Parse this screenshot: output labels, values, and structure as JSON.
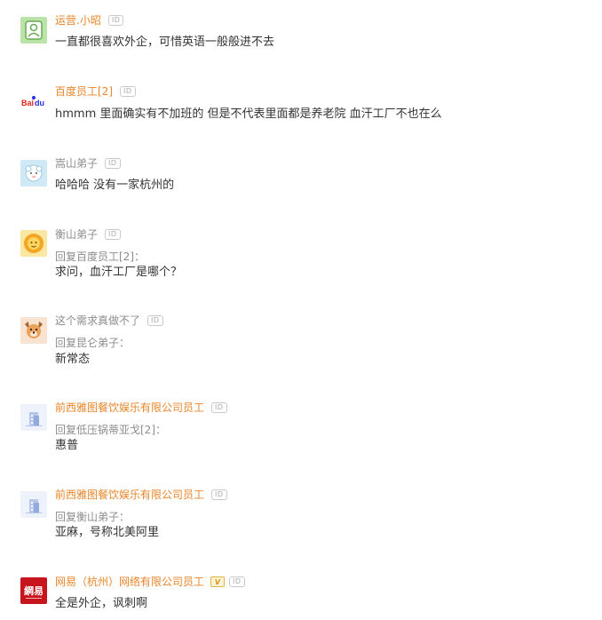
{
  "comments": [
    {
      "username": "运营.小昭",
      "name_style": "org",
      "id_badge": "ID",
      "avatar_icon": "green-person-avatar-icon",
      "text": "一直都很喜欢外企，可惜英语一般般进不去"
    },
    {
      "username": "百度员工[2]",
      "name_style": "org",
      "id_badge": "ID",
      "avatar_icon": "baidu-logo-icon",
      "text": "hmmm 里面确实有不加班的 但是不代表里面都是养老院 血汗工厂不也在么"
    },
    {
      "username": "嵩山弟子",
      "name_style": "anon",
      "id_badge": "ID",
      "avatar_icon": "sheep-avatar-icon",
      "text": "哈哈哈 没有一家杭州的"
    },
    {
      "username": "衡山弟子",
      "name_style": "anon",
      "id_badge": "ID",
      "avatar_icon": "lion-avatar-icon",
      "reply_to": "回复百度员工[2]：",
      "text": "求问，血汗工厂是哪个？"
    },
    {
      "username": "这个需求真做不了",
      "name_style": "anon",
      "id_badge": "ID",
      "avatar_icon": "dog-avatar-icon",
      "reply_to": "回复昆仑弟子：",
      "text": "新常态"
    },
    {
      "username": "前西雅图餐饮娱乐有限公司员工",
      "name_style": "org",
      "id_badge": "ID",
      "avatar_icon": "building-icon",
      "reply_to": "回复低压锅蒂亚戈[2]：",
      "text": "惠普"
    },
    {
      "username": "前西雅图餐饮娱乐有限公司员工",
      "name_style": "org",
      "id_badge": "ID",
      "avatar_icon": "building-icon",
      "reply_to": "回复衡山弟子：",
      "text": "亚麻，号称北美阿里"
    },
    {
      "username": "网易（杭州）网络有限公司员工",
      "name_style": "org",
      "verified_badge": "V",
      "id_badge": "ID",
      "avatar_icon": "netease-logo-icon",
      "avatar_text": "網易",
      "text": "全是外企，讽刺啊"
    }
  ],
  "colors": {
    "org_name": "#e8862a",
    "anon_name": "#8c8c8c",
    "body_text": "#333333"
  }
}
